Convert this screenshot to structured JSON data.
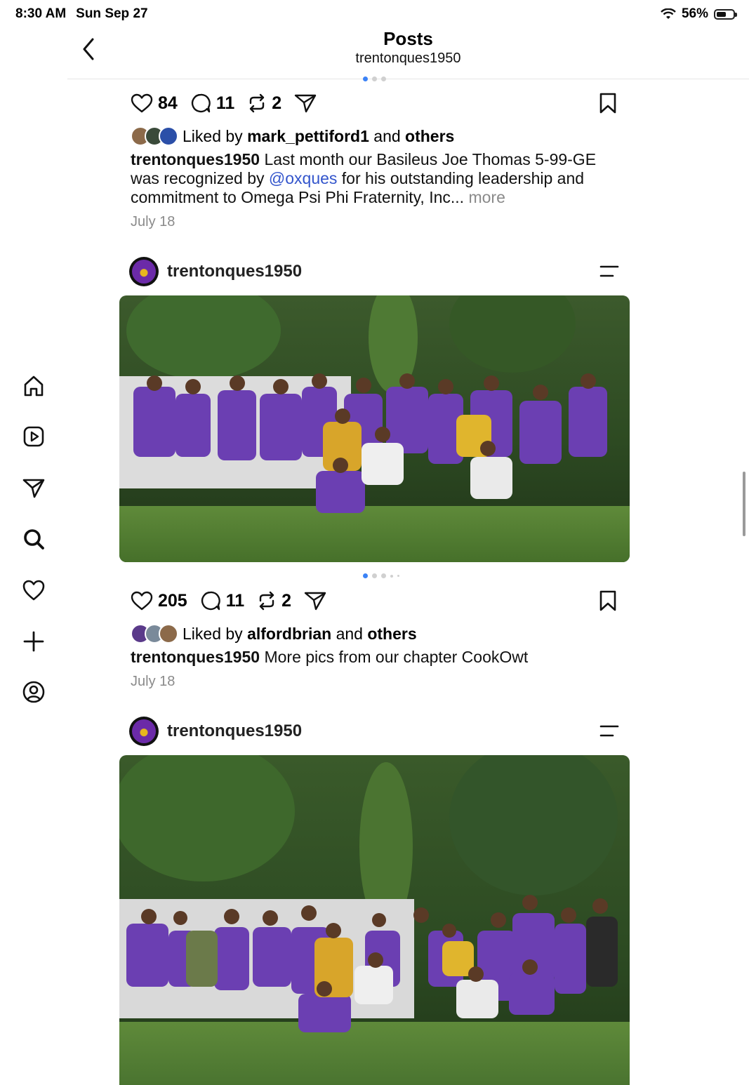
{
  "status": {
    "time": "8:30 AM",
    "date": "Sun Sep 27",
    "battery": "56%",
    "battery_level": 0.56
  },
  "header": {
    "title": "Posts",
    "subtitle": "trentonques1950"
  },
  "sidebar": {
    "icons": [
      "home-icon",
      "reels-icon",
      "send-icon",
      "search-icon",
      "heart-icon",
      "plus-icon",
      "profile-icon"
    ]
  },
  "post1": {
    "likes": "84",
    "comments": "11",
    "reposts": "2",
    "liked_prefix": "Liked by",
    "liked_user": "mark_pettiford1",
    "liked_and": "and",
    "liked_others": "others",
    "caption_user": "trentonques1950",
    "caption_a": "Last month our Basileus Joe Thomas 5-99-GE was recognized by",
    "caption_mention": "@oxques",
    "caption_b": "for his outstanding leadership and commitment to Omega Psi Phi Fraternity, Inc...",
    "more": "more",
    "date": "July 18"
  },
  "post2": {
    "username": "trentonques1950",
    "likes": "205",
    "comments": "11",
    "reposts": "2",
    "liked_prefix": "Liked by",
    "liked_user": "alfordbrian",
    "liked_and": "and",
    "liked_others": "others",
    "caption_user": "trentonques1950",
    "caption": "More pics from our chapter CookOwt",
    "date": "July 18"
  },
  "post3": {
    "username": "trentonques1950"
  },
  "colors": {
    "accent": "#3b82f6",
    "mention": "#3355cc",
    "purple": "#6b2aa8",
    "gold": "#e7b71e"
  }
}
